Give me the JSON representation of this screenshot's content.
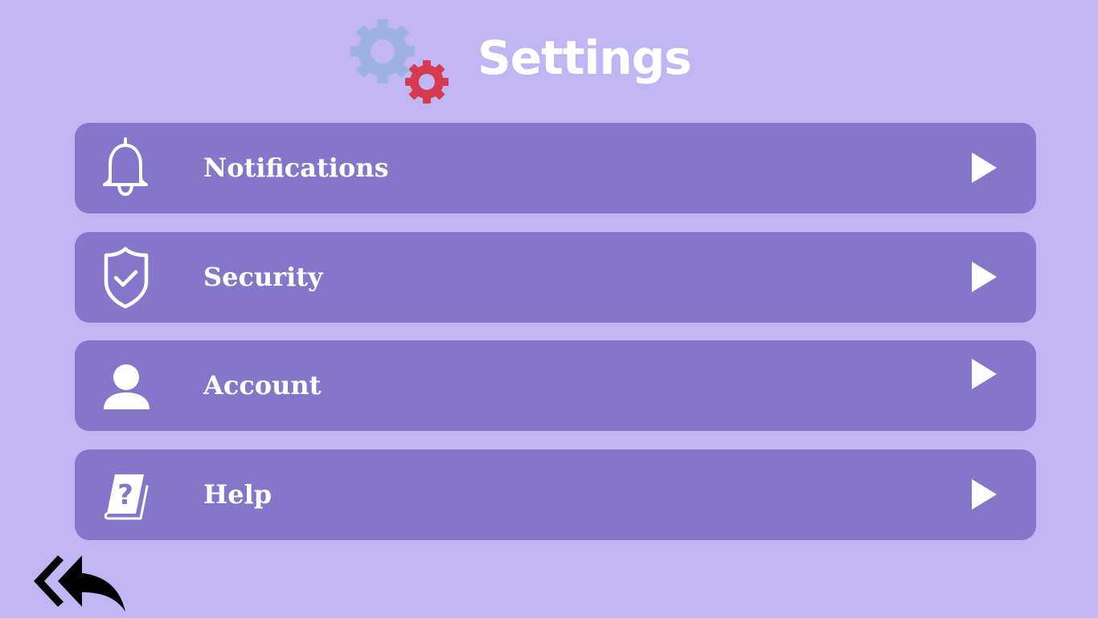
{
  "header": {
    "title": "Settings",
    "icon": "gears-icon",
    "gear_colors": [
      "#9db1e4",
      "#d63a4f"
    ]
  },
  "menu": {
    "items": [
      {
        "label": "Notifications",
        "icon": "bell-icon"
      },
      {
        "label": "Security",
        "icon": "shield-check-icon"
      },
      {
        "label": "Account",
        "icon": "user-icon"
      },
      {
        "label": "Help",
        "icon": "help-book-icon"
      }
    ]
  },
  "footer": {
    "back_icon": "reply-all-icon"
  },
  "colors": {
    "background": "#c1b6f3",
    "card": "#8576cc",
    "text": "#ffffff"
  }
}
